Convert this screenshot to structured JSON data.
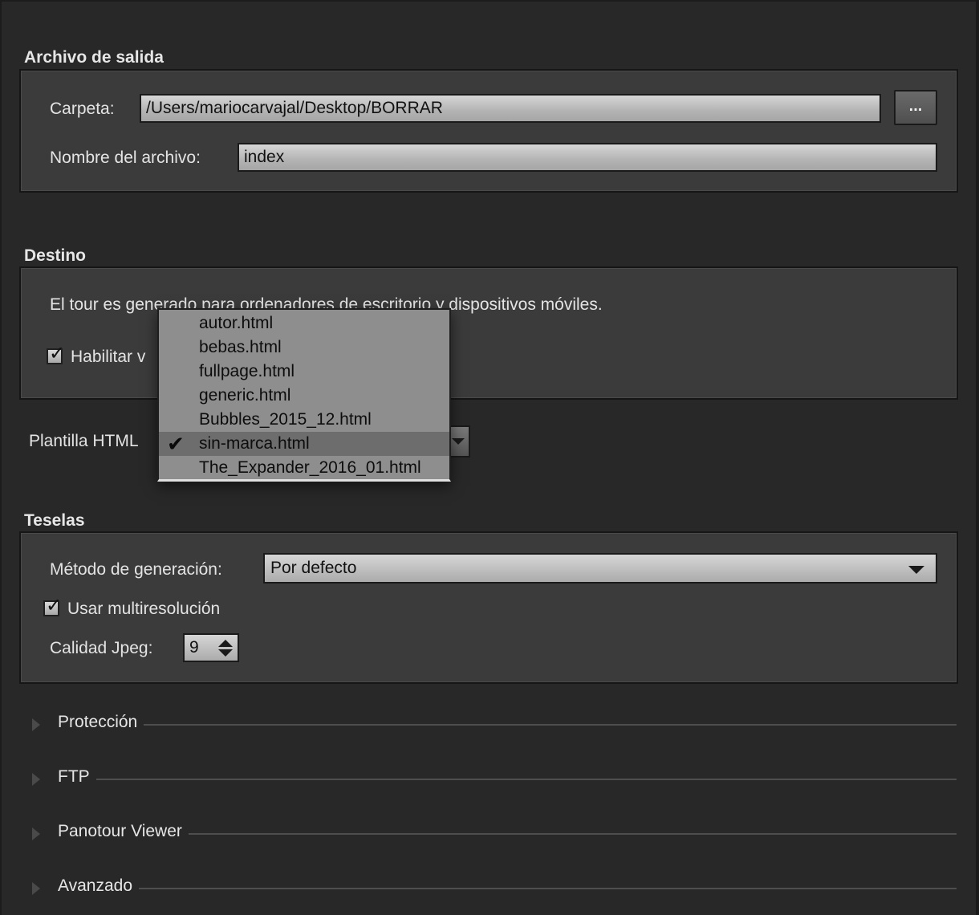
{
  "output": {
    "title": "Archivo de salida",
    "folder_label": "Carpeta:",
    "folder_value": "/Users/mariocarvajal/Desktop/BORRAR",
    "browse_label": "...",
    "filename_label": "Nombre del archivo:",
    "filename_value": "index"
  },
  "destination": {
    "title": "Destino",
    "description": "El tour es generado para ordenadores de escritorio y dispositivos móviles.",
    "checkbox_label_visible": "Habilitar v",
    "checkbox_checked": true
  },
  "template": {
    "label": "Plantilla HTML",
    "options": [
      "autor.html",
      "bebas.html",
      "fullpage.html",
      "generic.html",
      "Bubbles_2015_12.html",
      "sin-marca.html",
      "The_Expander_2016_01.html"
    ],
    "selected": "sin-marca.html",
    "check_glyph": "✔"
  },
  "tiles": {
    "title": "Teselas",
    "method_label": "Método de generación:",
    "method_value": "Por defecto",
    "multires_label": "Usar multiresolución",
    "multires_checked": true,
    "quality_label": "Calidad Jpeg:",
    "quality_value": "9"
  },
  "collapsed_sections": [
    "Protección",
    "FTP",
    "Panotour Viewer",
    "Avanzado"
  ]
}
